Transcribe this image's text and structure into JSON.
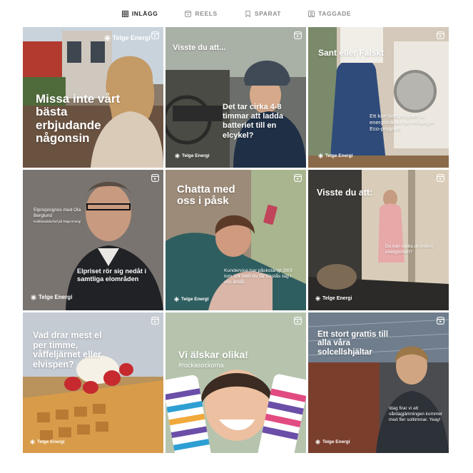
{
  "tabs": [
    {
      "label": "INLÄGG",
      "icon": "grid-icon",
      "active": true
    },
    {
      "label": "REELS",
      "icon": "reels-icon",
      "active": false
    },
    {
      "label": "SPARAT",
      "icon": "bookmark-icon",
      "active": false
    },
    {
      "label": "TAGGADE",
      "icon": "tagged-icon",
      "active": false
    }
  ],
  "brand": "Telge Energi",
  "posts": [
    {
      "headline": "Missa inte vårt bästa erbjudande någonsin",
      "icon": "reel-icon"
    },
    {
      "headline": "Visste du att...",
      "body": "Det tar cirka 4-8 timmar att ladda batteriet till en elcykel?",
      "icon": "reel-icon"
    },
    {
      "headline": "Sant eller Falskt",
      "body": "Ett kort tvättprogram är energisnålare än ett längre Eco-program",
      "icon": "reel-icon"
    },
    {
      "small_title": "Elprisprognos med Ola Berglund",
      "small_sub": "Krafthandelschef på Telge Energi",
      "body": "Elpriset rör sig nedåt i samtliga elområden",
      "icon": "reel-icon"
    },
    {
      "headline": "Chatta med oss i påsk",
      "body": "Kundervice har påskstängt 29/3 tom 1/4 men du får förstås tag i oss ändå.",
      "icon": "reel-icon"
    },
    {
      "headline": "Visste du att:",
      "body": "Du kan vädra ut vintern energismart?",
      "icon": "reel-icon"
    },
    {
      "headline": "Vad drar mest el per timme, våffeljärnet eller elvispen?",
      "icon": "reel-icon"
    },
    {
      "headline": "Vi älskar olika!",
      "hashtag": "#rockasockorna",
      "icon": "reel-icon"
    },
    {
      "headline": "Ett stort grattis till alla våra solcellshjältar",
      "body": "Idag firar vi att vårdagjämningen kommer med fler soltimmar. Yeay!",
      "icon": "reel-icon"
    }
  ],
  "colors": {
    "tab_active": "#262626",
    "tab_inactive": "#8e8e8e"
  }
}
